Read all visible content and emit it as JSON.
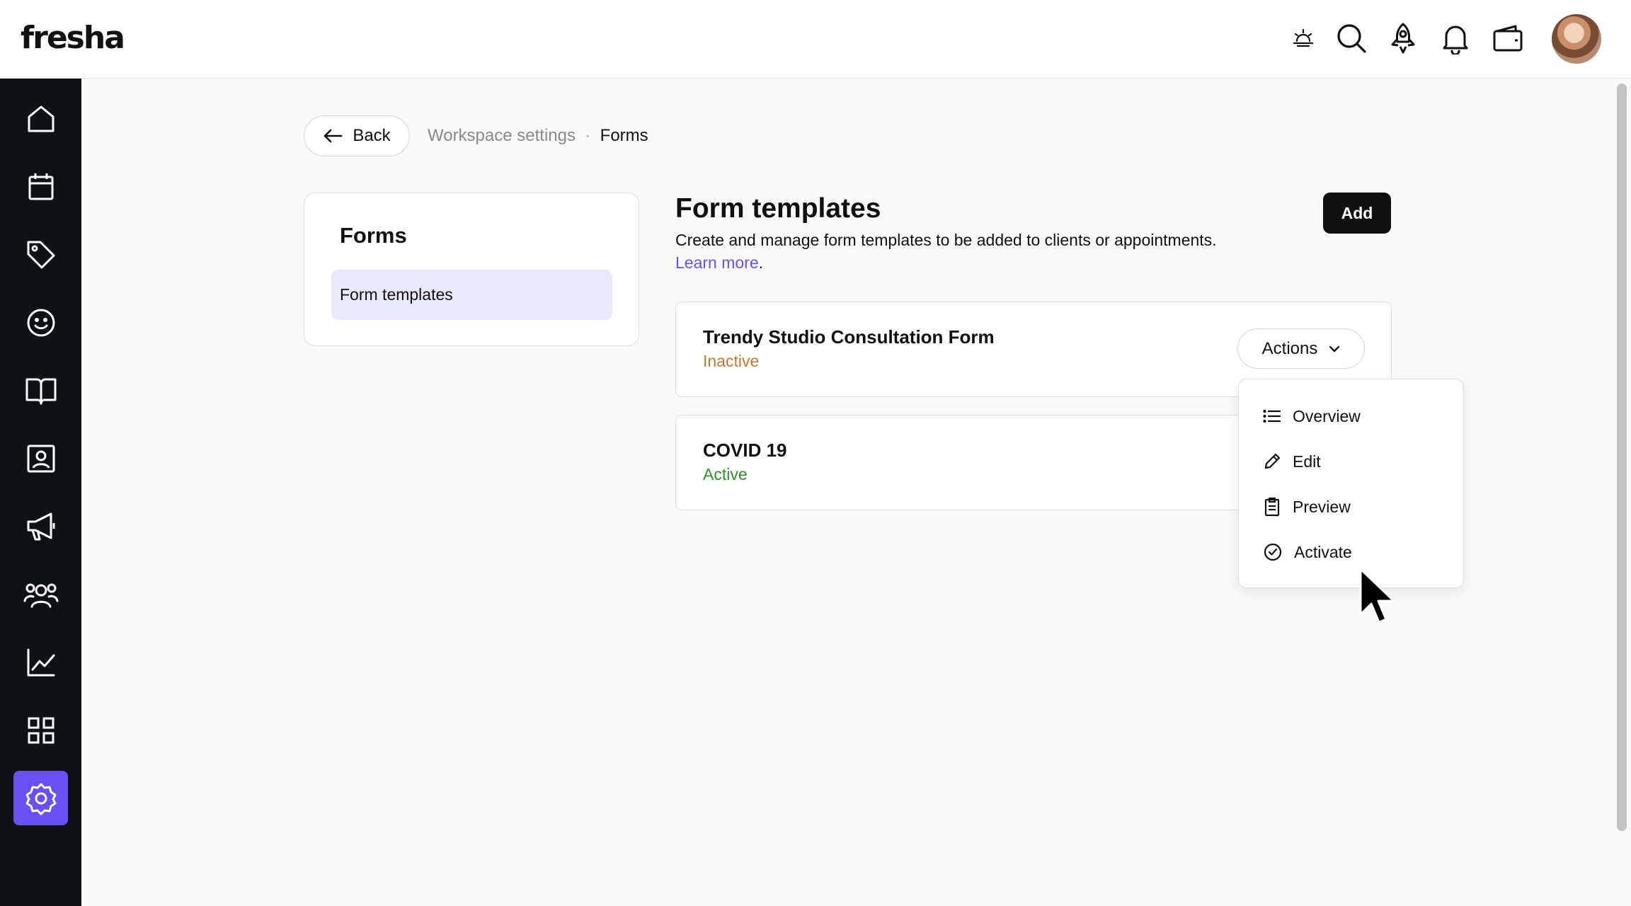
{
  "app": {
    "logo": "fresha"
  },
  "header": {
    "icons": [
      "sunrise-icon",
      "search-icon",
      "rocket-icon",
      "bell-icon",
      "wallet-icon",
      "avatar"
    ]
  },
  "sidebar": {
    "items": [
      {
        "name": "home-icon",
        "active": false
      },
      {
        "name": "calendar-icon",
        "active": false
      },
      {
        "name": "tag-icon",
        "active": false
      },
      {
        "name": "smiley-icon",
        "active": false
      },
      {
        "name": "book-icon",
        "active": false
      },
      {
        "name": "contact-card-icon",
        "active": false
      },
      {
        "name": "megaphone-icon",
        "active": false
      },
      {
        "name": "team-icon",
        "active": false
      },
      {
        "name": "chart-icon",
        "active": false
      },
      {
        "name": "apps-grid-icon",
        "active": false
      },
      {
        "name": "settings-icon",
        "active": true
      }
    ]
  },
  "breadcrumb": {
    "back_label": "Back",
    "parent": "Workspace settings",
    "separator": "·",
    "current": "Forms"
  },
  "settings_nav": {
    "title": "Forms",
    "items": [
      {
        "label": "Form templates",
        "selected": true
      }
    ]
  },
  "main": {
    "title": "Form templates",
    "description": "Create and manage form templates to be added to clients or appointments.",
    "learn_more": "Learn more",
    "learn_more_suffix": ".",
    "add_label": "Add",
    "forms": [
      {
        "name": "Trendy Studio Consultation Form",
        "status": "Inactive"
      },
      {
        "name": "COVID 19",
        "status": "Active"
      }
    ],
    "actions_label": "Actions"
  },
  "dropdown": {
    "items": [
      {
        "label": "Overview",
        "icon": "list-icon"
      },
      {
        "label": "Edit",
        "icon": "pencil-icon"
      },
      {
        "label": "Preview",
        "icon": "clipboard-icon"
      },
      {
        "label": "Activate",
        "icon": "check-circle-icon"
      }
    ]
  },
  "colors": {
    "accent": "#6950f3",
    "inactive": "#c7772c",
    "active": "#2e8f2a",
    "sidebar": "#0e1216"
  }
}
